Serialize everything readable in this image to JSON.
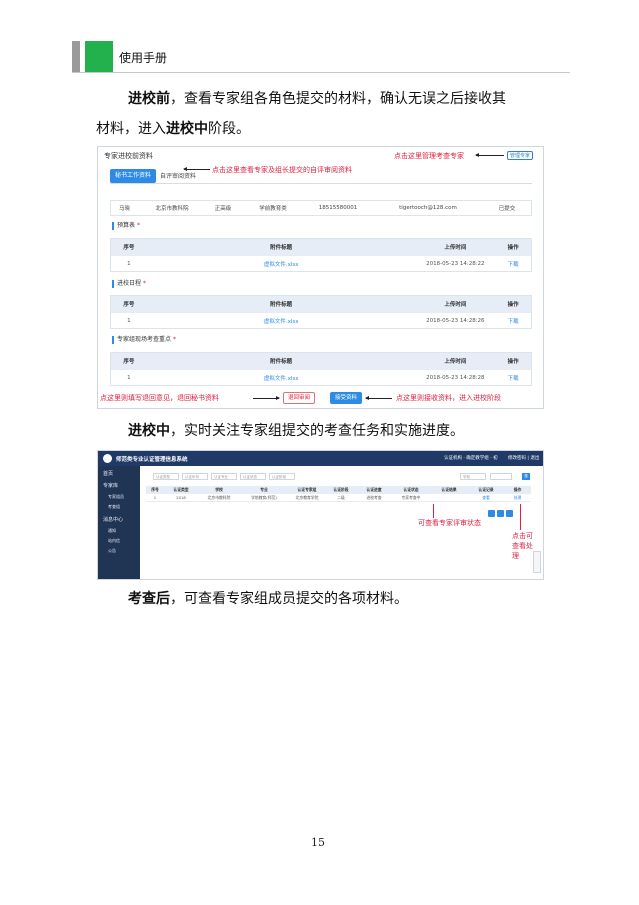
{
  "header": {
    "title": "使用手册"
  },
  "para1": {
    "line1_bold": "进校前",
    "line1_rest": "，查看专家组各角色提交的材料，确认无误之后接收其",
    "line2_start": "材料，进入",
    "line2_bold": "进校中",
    "line2_end": "阶段。"
  },
  "shot1": {
    "title": "专家进校前资料",
    "manage_annotation": "点击这里管理考查专家",
    "manage_button": "管理专家",
    "tabs": [
      "秘书工作资料",
      "自评审阅资料"
    ],
    "tab_annotation": "点击这里查看专家及组长提交的自评审阅资料",
    "info": [
      "马晓",
      "北京市教科院",
      "正高级",
      "学前教育类",
      "18515580001",
      "tigertooch@128.com",
      "已提交"
    ],
    "table_headers": [
      "序号",
      "附件标题",
      "上传时间",
      "操作"
    ],
    "sections": [
      {
        "label": "预算表",
        "star": "*",
        "row": [
          "1",
          "虚拟文件.xlsx",
          "2018-05-23 14:28:22",
          "下载"
        ]
      },
      {
        "label": "进校日程",
        "star": "*",
        "row": [
          "1",
          "虚拟文件.xlsx",
          "2018-05-23 14:28:26",
          "下载"
        ]
      },
      {
        "label": "专家组现场考查重点",
        "star": "*",
        "row": [
          "1",
          "虚拟文件.xlsx",
          "2018-05-23 14:28:28",
          "下载"
        ]
      }
    ],
    "return_annotation": "点这里则填写退回意见，退回秘书资料",
    "return_button": "退回审阅",
    "accept_button": "接受资料",
    "accept_annotation": "点这里则接收资料，进入进校阶段"
  },
  "para2": {
    "bold": "进校中",
    "rest": "，实时关注专家组提交的考查任务和实施进度。"
  },
  "shot2": {
    "app_title": "师范类专业认证管理信息系统",
    "user_info": "认证机构 · 确定教学组 · 初",
    "user_links": "修改密码 | 退出",
    "sidebar": [
      "首页",
      "专家库",
      "专家组员",
      "考查组",
      "消息中心",
      "通知",
      "站内信",
      "公告"
    ],
    "filters": [
      "认证类型",
      "认证年份",
      "认证专业",
      "认证状态",
      "认证阶段"
    ],
    "search_placeholder": "学校",
    "search_btn": "搜",
    "table_headers": [
      "序号",
      "认证类型",
      "学校",
      "专业",
      "认证专家组",
      "认证阶段",
      "认证进度",
      "认证状态",
      "认证结果",
      "认证记录",
      "操作"
    ],
    "table_row": [
      "1",
      "2018",
      "北京市教科院",
      "学前教育(师范)",
      "北京教育学院",
      "二级",
      "进校考查",
      "专家考查中",
      "",
      "查看",
      "处理"
    ],
    "status_annotation": "可查看专家评审状态",
    "action_annotation": [
      "点击可",
      "查看处",
      "理"
    ]
  },
  "para3": {
    "bold": "考查后",
    "rest": "，可查看专家组成员提交的各项材料。"
  },
  "page_number": "15"
}
